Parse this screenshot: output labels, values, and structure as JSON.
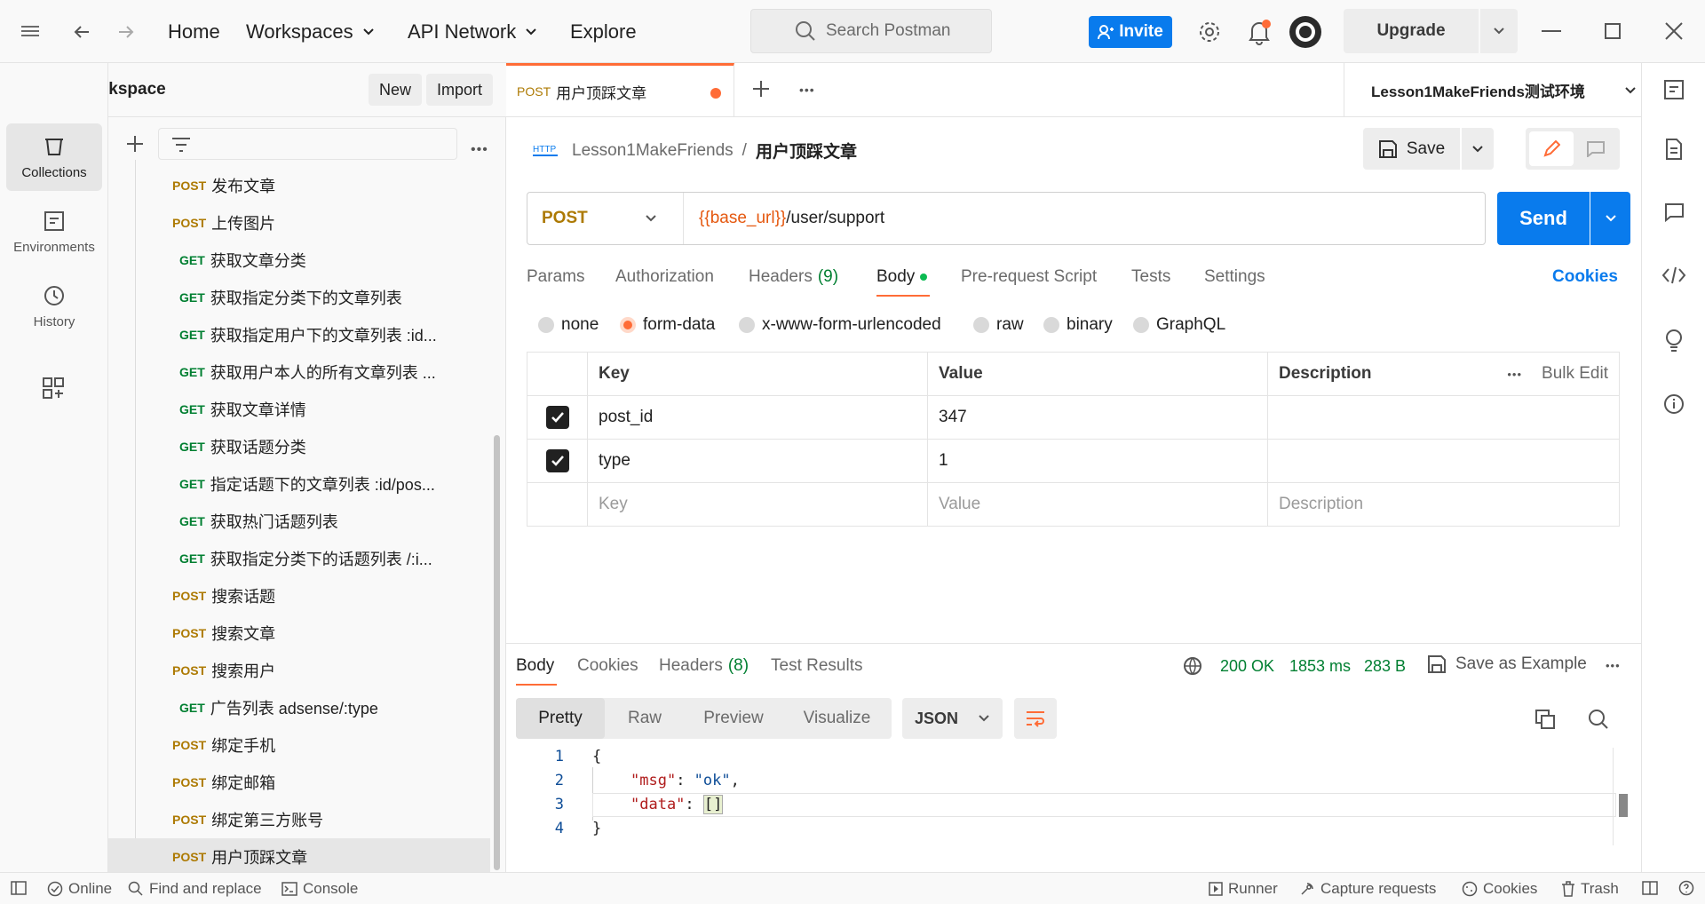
{
  "topbar": {
    "nav": [
      "Home",
      "Workspaces",
      "API Network",
      "Explore"
    ],
    "search_placeholder": "Search Postman",
    "invite_label": "Invite",
    "upgrade_label": "Upgrade"
  },
  "rail": {
    "items": [
      {
        "label": "Collections",
        "icon": "collections-icon"
      },
      {
        "label": "Environments",
        "icon": "environments-icon"
      },
      {
        "label": "History",
        "icon": "history-icon"
      }
    ]
  },
  "workspace": {
    "name": "My Workspace",
    "new_label": "New",
    "import_label": "Import"
  },
  "sidebar": {
    "requests": [
      {
        "method": "POST",
        "name": "发布文章",
        "indent": 0
      },
      {
        "method": "POST",
        "name": "上传图片",
        "indent": 0
      },
      {
        "method": "GET",
        "name": "获取文章分类",
        "indent": 1
      },
      {
        "method": "GET",
        "name": "获取指定分类下的文章列表",
        "indent": 1
      },
      {
        "method": "GET",
        "name": "获取指定用户下的文章列表 :id...",
        "indent": 1
      },
      {
        "method": "GET",
        "name": "获取用户本人的所有文章列表 ...",
        "indent": 1
      },
      {
        "method": "GET",
        "name": "获取文章详情",
        "indent": 1
      },
      {
        "method": "GET",
        "name": "获取话题分类",
        "indent": 1
      },
      {
        "method": "GET",
        "name": "指定话题下的文章列表 :id/pos...",
        "indent": 1
      },
      {
        "method": "GET",
        "name": "获取热门话题列表",
        "indent": 1
      },
      {
        "method": "GET",
        "name": "获取指定分类下的话题列表 /:i...",
        "indent": 1
      },
      {
        "method": "POST",
        "name": "搜索话题",
        "indent": 0
      },
      {
        "method": "POST",
        "name": "搜索文章",
        "indent": 0
      },
      {
        "method": "POST",
        "name": "搜索用户",
        "indent": 0
      },
      {
        "method": "GET",
        "name": "广告列表 adsense/:type",
        "indent": 1
      },
      {
        "method": "POST",
        "name": "绑定手机",
        "indent": 0
      },
      {
        "method": "POST",
        "name": "绑定邮箱",
        "indent": 0
      },
      {
        "method": "POST",
        "name": "绑定第三方账号",
        "indent": 0
      },
      {
        "method": "POST",
        "name": "用户顶踩文章",
        "indent": 0,
        "selected": true
      }
    ]
  },
  "tab": {
    "method": "POST",
    "title": "用户顶踩文章",
    "environment": "Lesson1MakeFriends测试环境"
  },
  "request": {
    "collection": "Lesson1MakeFriends",
    "separator": "/",
    "name": "用户顶踩文章",
    "save_label": "Save",
    "method": "POST",
    "url_var": "{{base_url}}",
    "url_path": "/user/support",
    "send_label": "Send",
    "tabs": [
      "Params",
      "Authorization",
      "Headers",
      "Body",
      "Pre-request Script",
      "Tests",
      "Settings"
    ],
    "headers_count": "(9)",
    "cookies_label": "Cookies",
    "body_types": [
      "none",
      "form-data",
      "x-www-form-urlencoded",
      "raw",
      "binary",
      "GraphQL"
    ],
    "selected_body_type": "form-data",
    "table": {
      "headers": [
        "Key",
        "Value",
        "Description"
      ],
      "bulk_edit": "Bulk Edit",
      "rows": [
        {
          "key": "post_id",
          "value": "347",
          "checked": true
        },
        {
          "key": "type",
          "value": "1",
          "checked": true
        }
      ],
      "placeholder": {
        "key": "Key",
        "value": "Value",
        "description": "Description"
      }
    }
  },
  "response": {
    "tabs": [
      "Body",
      "Cookies",
      "Headers",
      "Test Results"
    ],
    "headers_count": "(8)",
    "status": "200 OK",
    "time": "1853 ms",
    "size": "283 B",
    "save_example": "Save as Example",
    "views": [
      "Pretty",
      "Raw",
      "Preview",
      "Visualize"
    ],
    "format": "JSON",
    "lines": [
      "1",
      "2",
      "3",
      "4"
    ],
    "code": {
      "open": "{",
      "k1": "\"msg\"",
      "v1": "\"ok\"",
      "k2": "\"data\"",
      "v2": "[]",
      "close": "}"
    }
  },
  "statusbar": {
    "online": "Online",
    "find_replace": "Find and replace",
    "console": "Console",
    "runner": "Runner",
    "capture": "Capture requests",
    "cookies": "Cookies",
    "trash": "Trash"
  },
  "colors": {
    "accent": "#097bed",
    "post": "#ad7a03",
    "get": "#007f31",
    "orange": "#ff6c37"
  }
}
